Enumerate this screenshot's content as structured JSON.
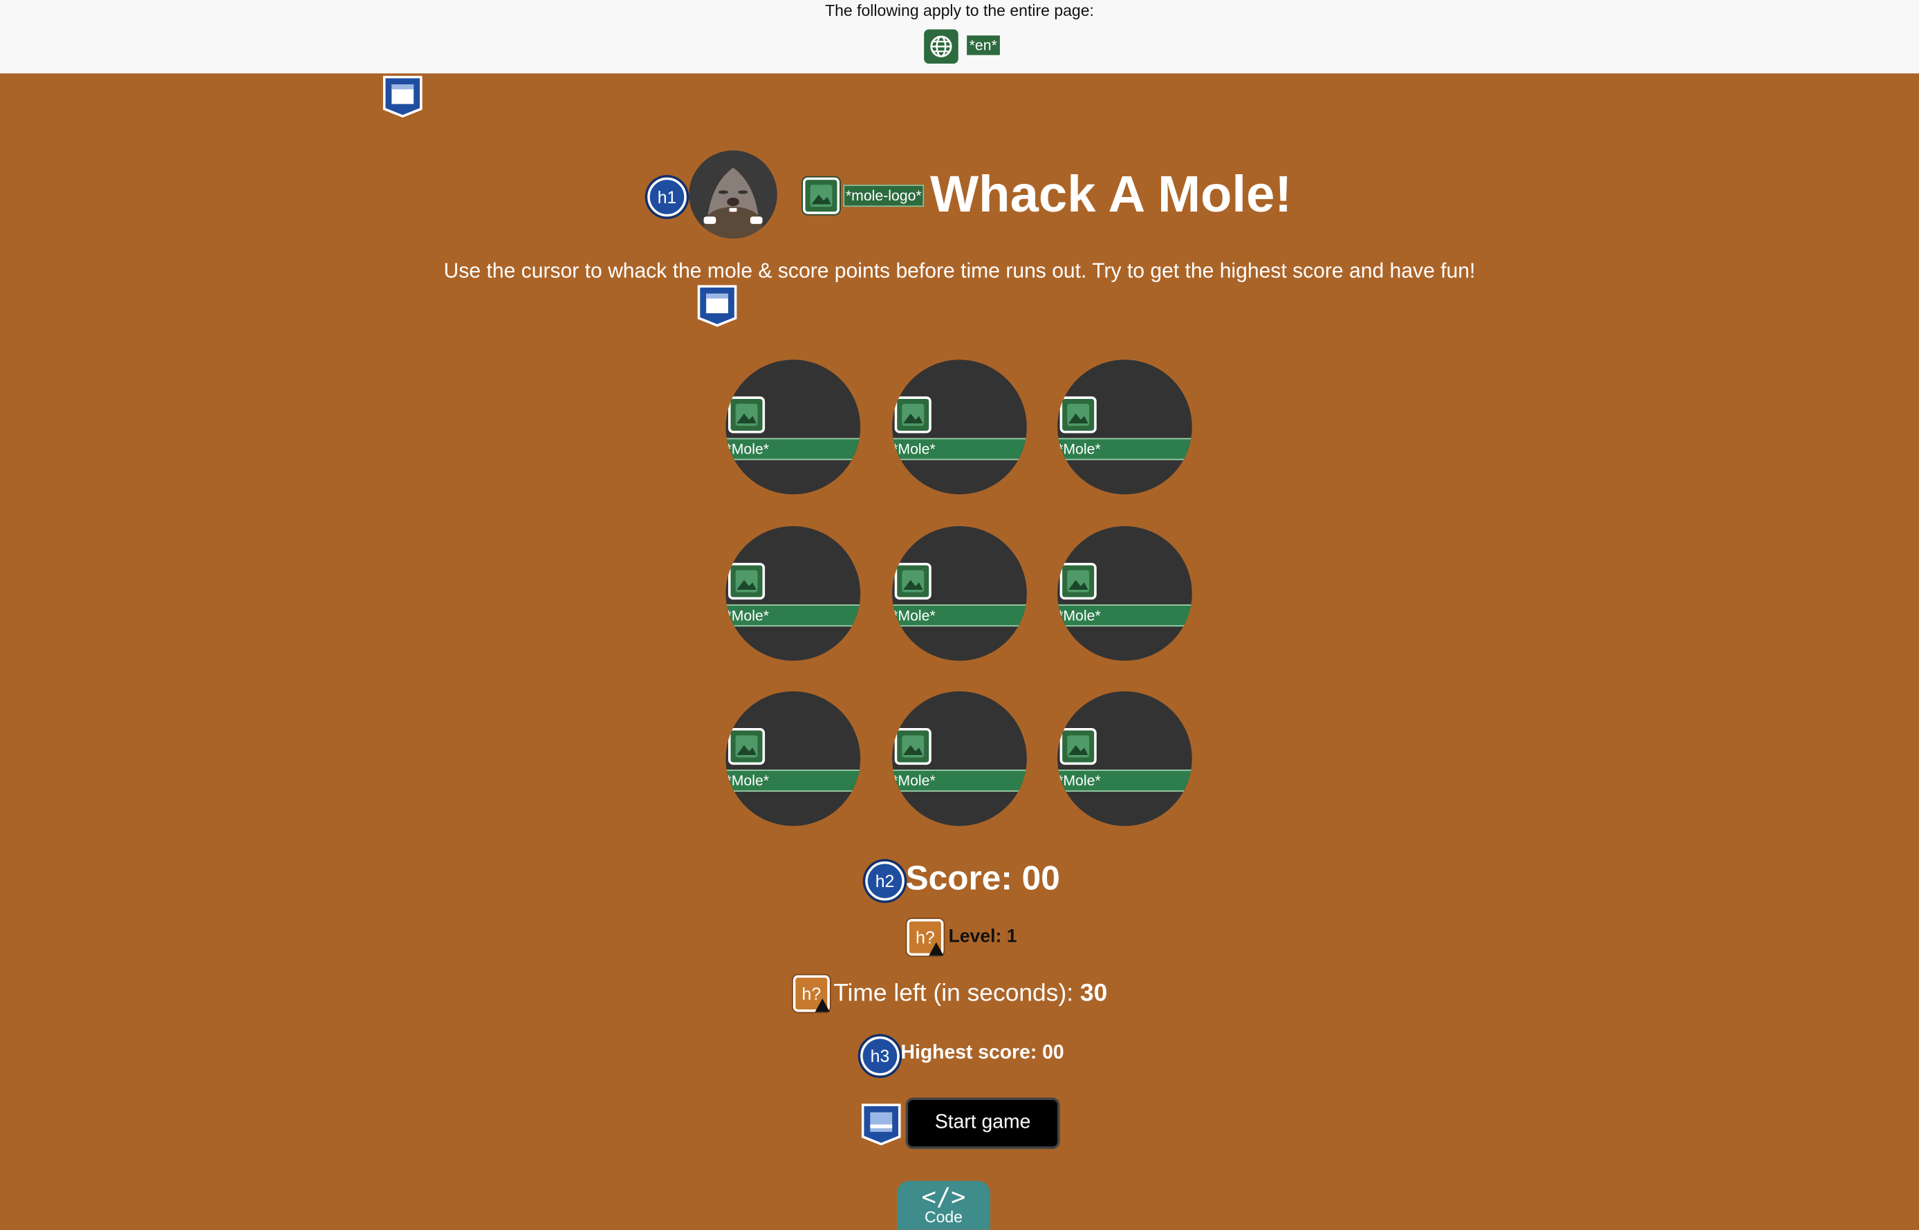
{
  "topbar": {
    "notice": "The following apply to the entire page:",
    "lang_tag": "*en*",
    "globe_icon": "globe-icon"
  },
  "header": {
    "heading_badge": "h1",
    "logo_alt_tag": "*mole-logo*",
    "title": "Whack A Mole!",
    "subtitle": "Use the cursor to whack the mole & score points before time runs out. Try to get the highest score and have fun!"
  },
  "board": {
    "holes": [
      {
        "label": "*Mole*"
      },
      {
        "label": "*Mole*"
      },
      {
        "label": "*Mole*"
      },
      {
        "label": "*Mole*"
      },
      {
        "label": "*Mole*"
      },
      {
        "label": "*Mole*"
      },
      {
        "label": "*Mole*"
      },
      {
        "label": "*Mole*"
      },
      {
        "label": "*Mole*"
      }
    ]
  },
  "stats": {
    "score_badge": "h2",
    "score_label": "Score: ",
    "score_value": "00",
    "level_badge": "h?",
    "level_label": "Level: ",
    "level_value": "1",
    "time_badge": "h?",
    "time_label": "Time left (in seconds): ",
    "time_value": "30",
    "highest_badge": "h3",
    "highest_label": "Highest score: ",
    "highest_value": "00"
  },
  "controls": {
    "start_label": "Start game"
  },
  "code_tab": {
    "glyph": "</>",
    "label": "Code"
  },
  "colors": {
    "background": "#ab6428",
    "hole": "#333333",
    "alt_tag": "#2d6a3e",
    "heading_badge": "#1f4ea1",
    "button": "#000000"
  }
}
